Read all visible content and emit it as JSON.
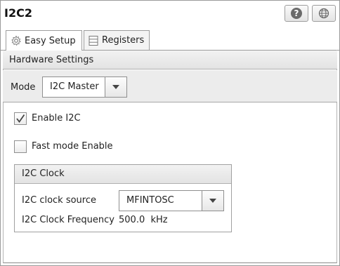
{
  "window": {
    "title": "I2C2"
  },
  "header_buttons": [
    {
      "icon": "help-icon",
      "label": "?"
    },
    {
      "icon": "globe-icon"
    }
  ],
  "tabs": [
    {
      "label": "Easy Setup",
      "icon": "gear-icon",
      "active": true
    },
    {
      "label": "Registers",
      "icon": "registers-icon",
      "active": false
    }
  ],
  "hardware": {
    "title": "Hardware Settings",
    "mode_label": "Mode",
    "mode_value": "I2C Master"
  },
  "options": {
    "enable_i2c": {
      "label": "Enable I2C",
      "checked": true
    },
    "fast_mode": {
      "label": "Fast mode Enable",
      "checked": false
    }
  },
  "clock": {
    "title": "I2C Clock",
    "source_label": "I2C clock source",
    "source_value": "MFINTOSC",
    "freq_label": "I2C Clock Frequency",
    "freq_value": "500.0  kHz"
  }
}
